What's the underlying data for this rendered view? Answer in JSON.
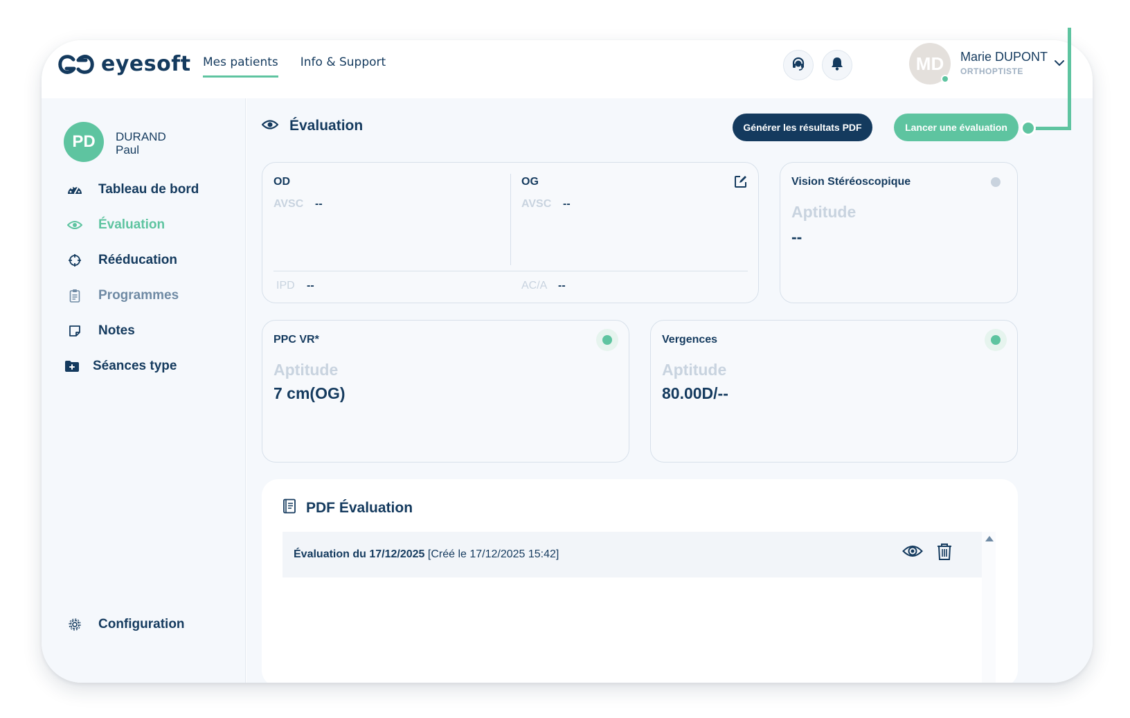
{
  "app": {
    "logo_text": "eyesoft"
  },
  "nav": {
    "items": [
      {
        "label": "Mes patients"
      },
      {
        "label": "Info & Support"
      }
    ]
  },
  "user": {
    "initials": "MD",
    "name": "Marie DUPONT",
    "role": "ORTHOPTISTE"
  },
  "patient": {
    "initials": "PD",
    "last_name": "DURAND",
    "first_name": "Paul"
  },
  "sidebar": {
    "items": [
      {
        "label": "Tableau de bord",
        "icon": "dashboard-icon"
      },
      {
        "label": "Évaluation",
        "icon": "eye-icon"
      },
      {
        "label": "Rééducation",
        "icon": "crosshair-icon"
      },
      {
        "label": "Programmes",
        "icon": "clipboard-icon"
      },
      {
        "label": "Notes",
        "icon": "note-icon"
      },
      {
        "label": "Séances type",
        "icon": "folder-plus-icon"
      }
    ],
    "config_label": "Configuration"
  },
  "main": {
    "title": "Évaluation",
    "btn_pdf": "Générer les résultats PDF",
    "btn_launch": "Lancer une évaluation",
    "acuity": {
      "od_label": "OD",
      "og_label": "OG",
      "avsc_label": "AVSC",
      "od_avsc": "--",
      "og_avsc": "--",
      "ipd_label": "IPD",
      "ipd_value": "--",
      "aca_label": "AC/A",
      "aca_value": "--"
    },
    "stereo": {
      "title": "Vision Stéréoscopique",
      "aptitude": "Aptitude",
      "value": "--"
    },
    "ppc": {
      "title": "PPC VR*",
      "aptitude": "Aptitude",
      "value": "7 cm(OG)"
    },
    "vergences": {
      "title": "Vergences",
      "aptitude": "Aptitude",
      "value": "80.00D/--"
    },
    "pdf": {
      "title": "PDF Évaluation",
      "row_title": "Évaluation du 17/12/2025",
      "row_created": "[Créé le 17/12/2025 15:42]"
    }
  },
  "colors": {
    "navy": "#143a5e",
    "green": "#5ec4a0",
    "muted": "#c8d3df",
    "grey_dot": "#c9d3de"
  }
}
